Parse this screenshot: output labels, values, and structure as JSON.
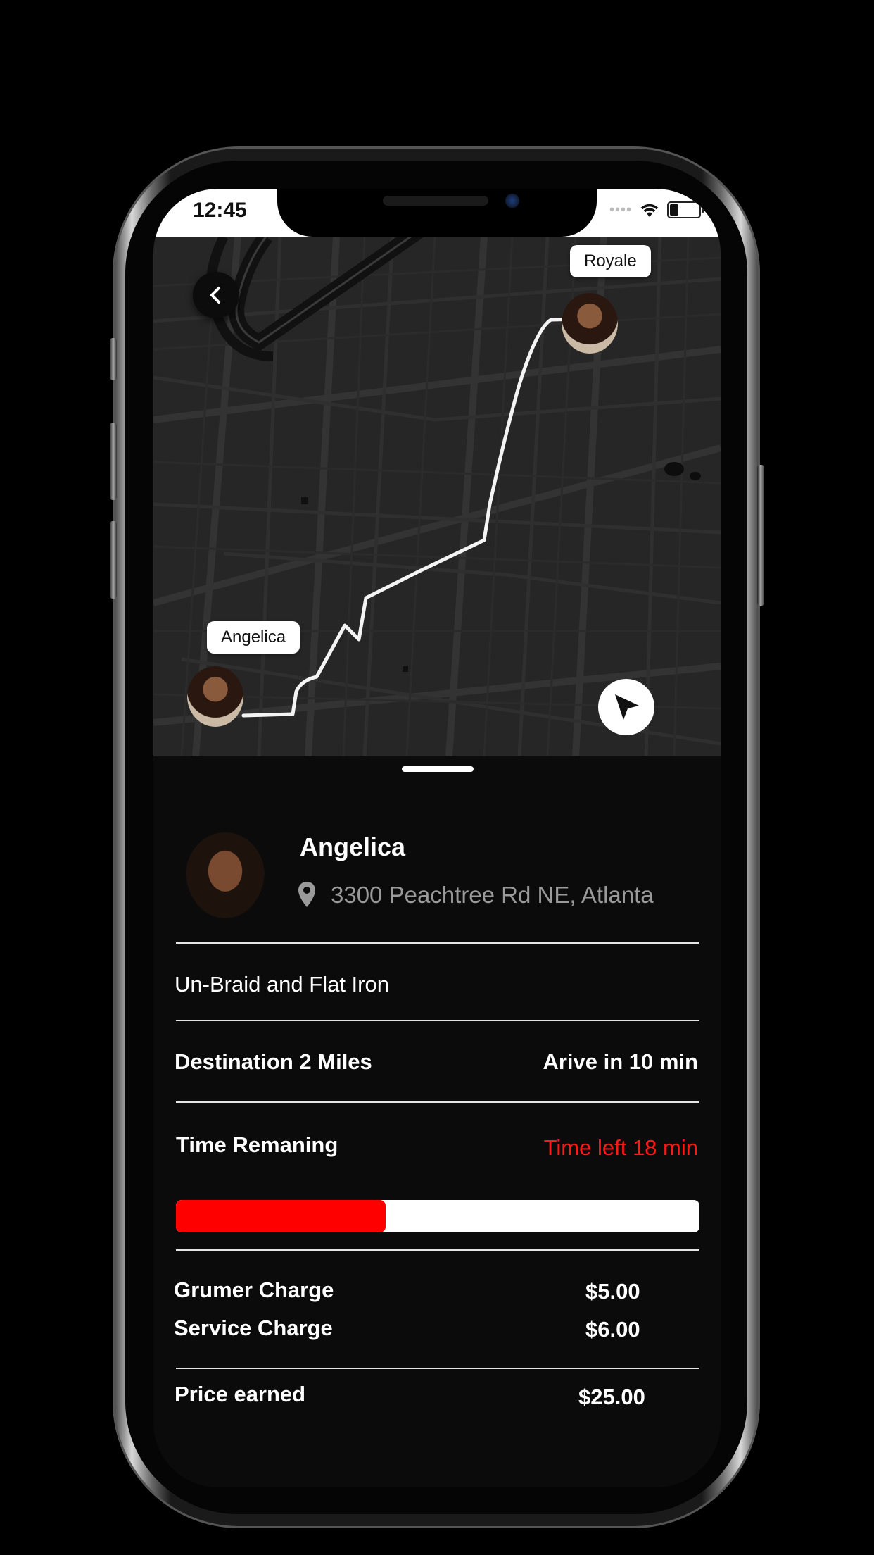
{
  "status_bar": {
    "time": "12:45",
    "signal_dots": "••••"
  },
  "map": {
    "back_icon": "chevron-left-icon",
    "destination_label": "Royale",
    "origin_label": "Angelica",
    "locate_icon": "navigation-arrow-icon",
    "route_color": "#ffffff"
  },
  "customer": {
    "name": "Angelica",
    "address": "3300 Peachtree Rd NE, Atlanta",
    "pin_icon": "location-pin-icon"
  },
  "service": {
    "name": "Un-Braid and Flat Iron"
  },
  "trip": {
    "destination": "Destination 2 Miles",
    "arrival": "Arive in 10 min"
  },
  "time": {
    "label": "Time Remaning",
    "left": "Time left 18 min",
    "progress_fraction": 0.4,
    "progress_color": "#ff0000"
  },
  "charges": [
    {
      "label": "Grumer Charge",
      "value": "$5.00"
    },
    {
      "label": "Service Charge",
      "value": "$6.00"
    }
  ],
  "earned": {
    "label": "Price earned",
    "value": "$25.00"
  }
}
